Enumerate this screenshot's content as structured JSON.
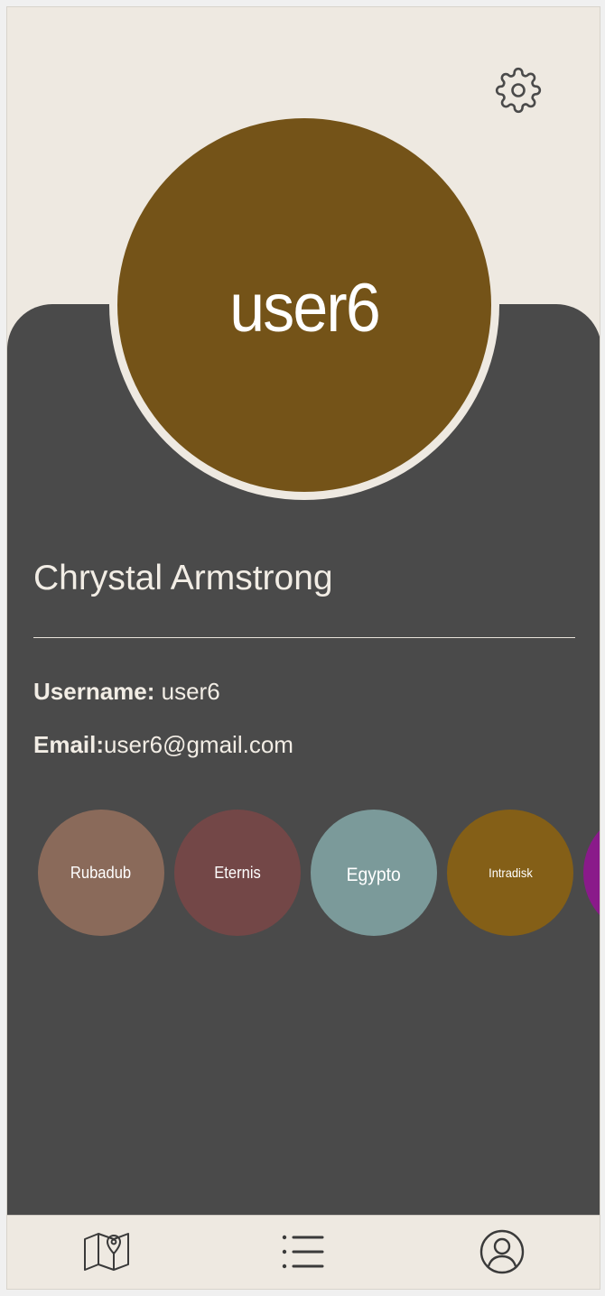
{
  "profile": {
    "avatar_text": "user6",
    "avatar_color": "#745318",
    "full_name": "Chrystal Armstrong",
    "username_label": "Username:",
    "username_value": "user6",
    "email_label": "Email:",
    "email_value": "user6@gmail.com"
  },
  "badges": [
    {
      "label": "Rubadub",
      "color": "#8a6a5a"
    },
    {
      "label": "Eternis",
      "color": "#734747"
    },
    {
      "label": "Egypto",
      "color": "#7b9a9a"
    },
    {
      "label": "Intradisk",
      "color": "#845f17"
    },
    {
      "label": "",
      "color": "#8a1a8a"
    }
  ],
  "header": {
    "settings_icon": "gear-icon"
  },
  "nav": {
    "items": [
      {
        "icon": "map-icon"
      },
      {
        "icon": "list-icon"
      },
      {
        "icon": "profile-icon"
      }
    ]
  },
  "colors": {
    "background": "#eee9e1",
    "card": "#4a4a4a",
    "text_light": "#f2ede5"
  }
}
